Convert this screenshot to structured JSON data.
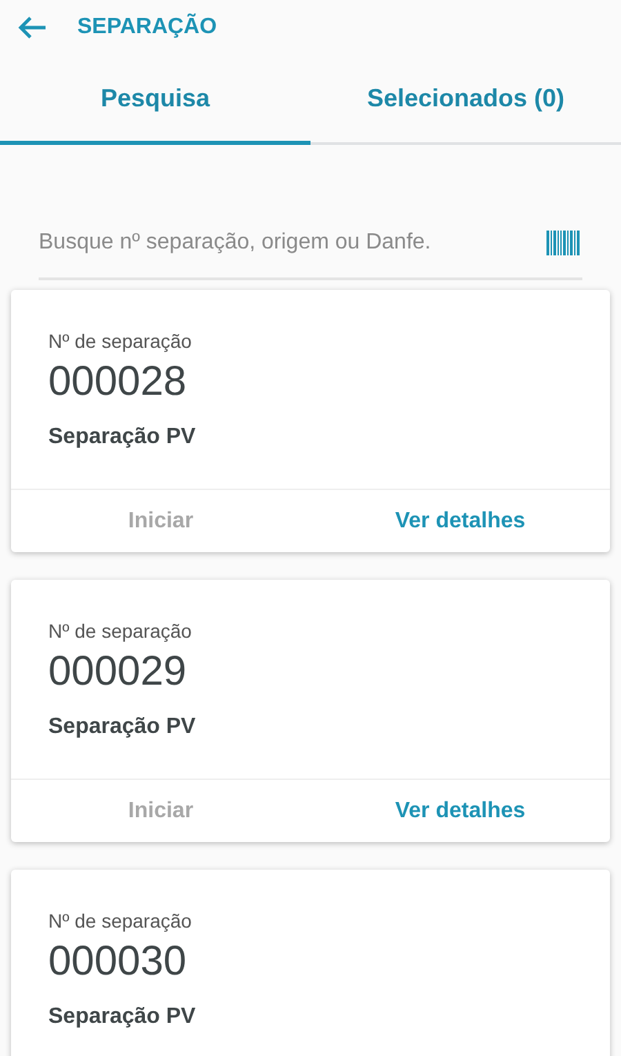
{
  "header": {
    "title": "SEPARAÇÃO"
  },
  "tabs": [
    {
      "label": "Pesquisa",
      "selected": true
    },
    {
      "label": "Selecionados (0)",
      "selected": false
    }
  ],
  "search": {
    "placeholder": "Busque nº separação, origem ou Danfe."
  },
  "cards": [
    {
      "label": "Nº de separação",
      "number": "000028",
      "type": "Separação PV",
      "actions": [
        {
          "label": "Iniciar",
          "disabled": true
        },
        {
          "label": "Ver detalhes",
          "disabled": false
        }
      ]
    },
    {
      "label": "Nº de separação",
      "number": "000029",
      "type": "Separação PV",
      "actions": [
        {
          "label": "Iniciar",
          "disabled": true
        },
        {
          "label": "Ver detalhes",
          "disabled": false
        }
      ]
    },
    {
      "label": "Nº de separação",
      "number": "000030",
      "type": "Separação PV"
    }
  ]
}
